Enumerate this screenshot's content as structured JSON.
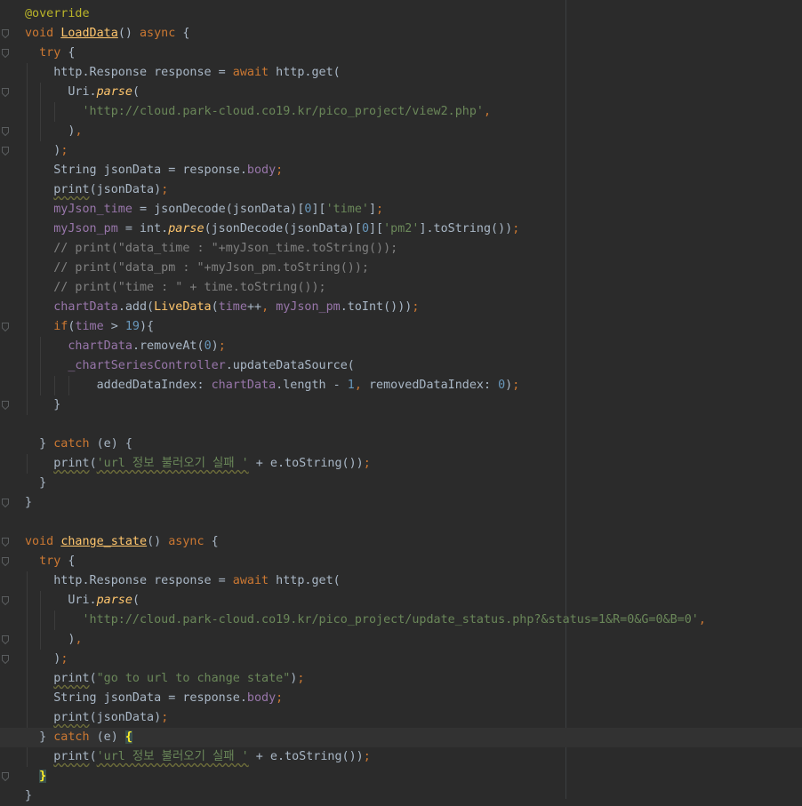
{
  "editor": {
    "lines": [
      [
        {
          "t": "@override",
          "c": "an"
        }
      ],
      [
        {
          "t": "void",
          "c": "kw"
        },
        {
          "t": " "
        },
        {
          "t": "LoadData",
          "c": "fn ul"
        },
        {
          "t": "() "
        },
        {
          "t": "async",
          "c": "kw"
        },
        {
          "t": " {"
        }
      ],
      [
        {
          "t": "  "
        },
        {
          "t": "try",
          "c": "kw"
        },
        {
          "t": " {"
        }
      ],
      [
        {
          "t": "    http.Response response = "
        },
        {
          "t": "await",
          "c": "kw"
        },
        {
          "t": " http.get("
        }
      ],
      [
        {
          "t": "      Uri."
        },
        {
          "t": "parse",
          "c": "fn it"
        },
        {
          "t": "("
        }
      ],
      [
        {
          "t": "        "
        },
        {
          "t": "'http://cloud.park-cloud.co19.kr/pico_project/view2.php'",
          "c": "str"
        },
        {
          "t": ",",
          "c": "kw"
        }
      ],
      [
        {
          "t": "      )"
        },
        {
          "t": ",",
          "c": "kw"
        }
      ],
      [
        {
          "t": "    )"
        },
        {
          "t": ";",
          "c": "kw"
        }
      ],
      [
        {
          "t": "    String jsonData = response."
        },
        {
          "t": "body",
          "c": "fld"
        },
        {
          "t": ";",
          "c": "kw"
        }
      ],
      [
        {
          "t": "    "
        },
        {
          "t": "print",
          "c": "wv"
        },
        {
          "t": "(jsonData)"
        },
        {
          "t": ";",
          "c": "kw"
        }
      ],
      [
        {
          "t": "    "
        },
        {
          "t": "myJson_time",
          "c": "fld"
        },
        {
          "t": " = jsonDecode(jsonData)["
        },
        {
          "t": "0",
          "c": "num"
        },
        {
          "t": "]["
        },
        {
          "t": "'time'",
          "c": "str"
        },
        {
          "t": "]"
        },
        {
          "t": ";",
          "c": "kw"
        }
      ],
      [
        {
          "t": "    "
        },
        {
          "t": "myJson_pm",
          "c": "fld"
        },
        {
          "t": " = int."
        },
        {
          "t": "parse",
          "c": "fn it"
        },
        {
          "t": "(jsonDecode(jsonData)["
        },
        {
          "t": "0",
          "c": "num"
        },
        {
          "t": "]["
        },
        {
          "t": "'pm2'",
          "c": "str"
        },
        {
          "t": "].toString())"
        },
        {
          "t": ";",
          "c": "kw"
        }
      ],
      [
        {
          "t": "    "
        },
        {
          "t": "// print(\"data_time : \"+myJson_time.toString());",
          "c": "cm"
        }
      ],
      [
        {
          "t": "    "
        },
        {
          "t": "// print(\"data_pm : \"+myJson_pm.toString());",
          "c": "cm"
        }
      ],
      [
        {
          "t": "    "
        },
        {
          "t": "// print(\"time : \" + time.toString());",
          "c": "cm"
        }
      ],
      [
        {
          "t": "    "
        },
        {
          "t": "chartData",
          "c": "fld"
        },
        {
          "t": ".add("
        },
        {
          "t": "LiveData",
          "c": "fn"
        },
        {
          "t": "("
        },
        {
          "t": "time",
          "c": "fld"
        },
        {
          "t": "++"
        },
        {
          "t": ",",
          "c": "kw"
        },
        {
          "t": " "
        },
        {
          "t": "myJson_pm",
          "c": "fld"
        },
        {
          "t": ".toInt()))"
        },
        {
          "t": ";",
          "c": "kw"
        }
      ],
      [
        {
          "t": "    "
        },
        {
          "t": "if",
          "c": "kw"
        },
        {
          "t": "("
        },
        {
          "t": "time",
          "c": "fld"
        },
        {
          "t": " > "
        },
        {
          "t": "19",
          "c": "num"
        },
        {
          "t": "){"
        }
      ],
      [
        {
          "t": "      "
        },
        {
          "t": "chartData",
          "c": "fld"
        },
        {
          "t": ".removeAt("
        },
        {
          "t": "0",
          "c": "num"
        },
        {
          "t": ")"
        },
        {
          "t": ";",
          "c": "kw"
        }
      ],
      [
        {
          "t": "      "
        },
        {
          "t": "_chartSeriesController",
          "c": "fld"
        },
        {
          "t": ".updateDataSource("
        }
      ],
      [
        {
          "t": "          addedDataIndex: "
        },
        {
          "t": "chartData",
          "c": "fld"
        },
        {
          "t": ".length - "
        },
        {
          "t": "1",
          "c": "num"
        },
        {
          "t": ",",
          "c": "kw"
        },
        {
          "t": " removedDataIndex: "
        },
        {
          "t": "0",
          "c": "num"
        },
        {
          "t": ")"
        },
        {
          "t": ";",
          "c": "kw"
        }
      ],
      [
        {
          "t": "    }"
        }
      ],
      [],
      [
        {
          "t": "  } "
        },
        {
          "t": "catch",
          "c": "kw"
        },
        {
          "t": " (e) {"
        }
      ],
      [
        {
          "t": "    "
        },
        {
          "t": "print",
          "c": "wv"
        },
        {
          "t": "("
        },
        {
          "t": "'url 정보 불러오기 실패 '",
          "c": "str wv"
        },
        {
          "t": " + e.toString())"
        },
        {
          "t": ";",
          "c": "kw"
        }
      ],
      [
        {
          "t": "  }"
        }
      ],
      [
        {
          "t": "}"
        }
      ],
      [],
      [
        {
          "t": "void",
          "c": "kw"
        },
        {
          "t": " "
        },
        {
          "t": "change_state",
          "c": "fn ul"
        },
        {
          "t": "() "
        },
        {
          "t": "async",
          "c": "kw"
        },
        {
          "t": " {"
        }
      ],
      [
        {
          "t": "  "
        },
        {
          "t": "try",
          "c": "kw"
        },
        {
          "t": " {"
        }
      ],
      [
        {
          "t": "    http.Response response = "
        },
        {
          "t": "await",
          "c": "kw"
        },
        {
          "t": " http.get("
        }
      ],
      [
        {
          "t": "      Uri."
        },
        {
          "t": "parse",
          "c": "fn it"
        },
        {
          "t": "("
        }
      ],
      [
        {
          "t": "        "
        },
        {
          "t": "'http://cloud.park-cloud.co19.kr/pico_project/update_status.php?&status=1&R=0&G=0&B=0'",
          "c": "str"
        },
        {
          "t": ",",
          "c": "kw"
        }
      ],
      [
        {
          "t": "      )"
        },
        {
          "t": ",",
          "c": "kw"
        }
      ],
      [
        {
          "t": "    )"
        },
        {
          "t": ";",
          "c": "kw"
        }
      ],
      [
        {
          "t": "    "
        },
        {
          "t": "print",
          "c": "wv"
        },
        {
          "t": "("
        },
        {
          "t": "\"go to url to change state\"",
          "c": "str"
        },
        {
          "t": ")"
        },
        {
          "t": ";",
          "c": "kw"
        }
      ],
      [
        {
          "t": "    String jsonData = response."
        },
        {
          "t": "body",
          "c": "fld"
        },
        {
          "t": ";",
          "c": "kw"
        }
      ],
      [
        {
          "t": "    "
        },
        {
          "t": "print",
          "c": "wv"
        },
        {
          "t": "(jsonData)"
        },
        {
          "t": ";",
          "c": "kw"
        }
      ],
      [
        {
          "t": "  } "
        },
        {
          "t": "catch",
          "c": "kw"
        },
        {
          "t": " (e) "
        },
        {
          "t": "{",
          "c": "brace-hl"
        }
      ],
      [
        {
          "t": "    "
        },
        {
          "t": "print",
          "c": "wv"
        },
        {
          "t": "("
        },
        {
          "t": "'url 정보 불러오기 실패 '",
          "c": "str wv"
        },
        {
          "t": " + e.toString())"
        },
        {
          "t": ";",
          "c": "kw"
        }
      ],
      [
        {
          "t": "  "
        },
        {
          "t": "}",
          "c": "brace-hl"
        }
      ],
      [
        {
          "t": "}"
        }
      ]
    ],
    "current_line": 37,
    "fold_lines": [
      1,
      2,
      4,
      6,
      7,
      16,
      20,
      25,
      27,
      28,
      30,
      32,
      33,
      37,
      39
    ]
  }
}
